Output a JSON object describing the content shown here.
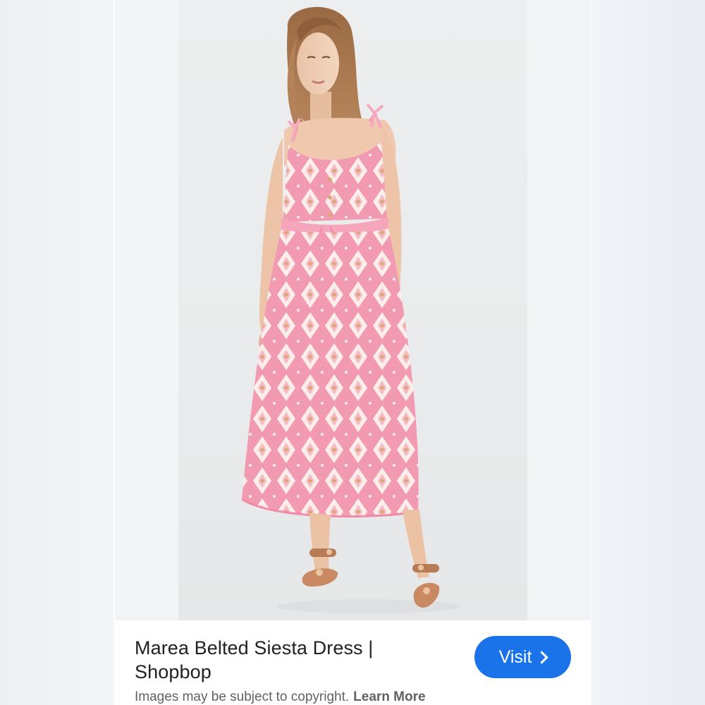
{
  "result": {
    "title": "Marea Belted Siesta Dress | Shopbop",
    "visit_label": "Visit",
    "copyright_notice": "Images may be subject to copyright.",
    "learn_more_label": "Learn More"
  },
  "icons": {
    "visit": "chevron-right-icon"
  },
  "colors": {
    "accent": "#1a73e8",
    "title_text": "#202124",
    "secondary_text": "#5f6368",
    "dress_pink": "#f08aa8",
    "dress_cream": "#fbeeea"
  }
}
